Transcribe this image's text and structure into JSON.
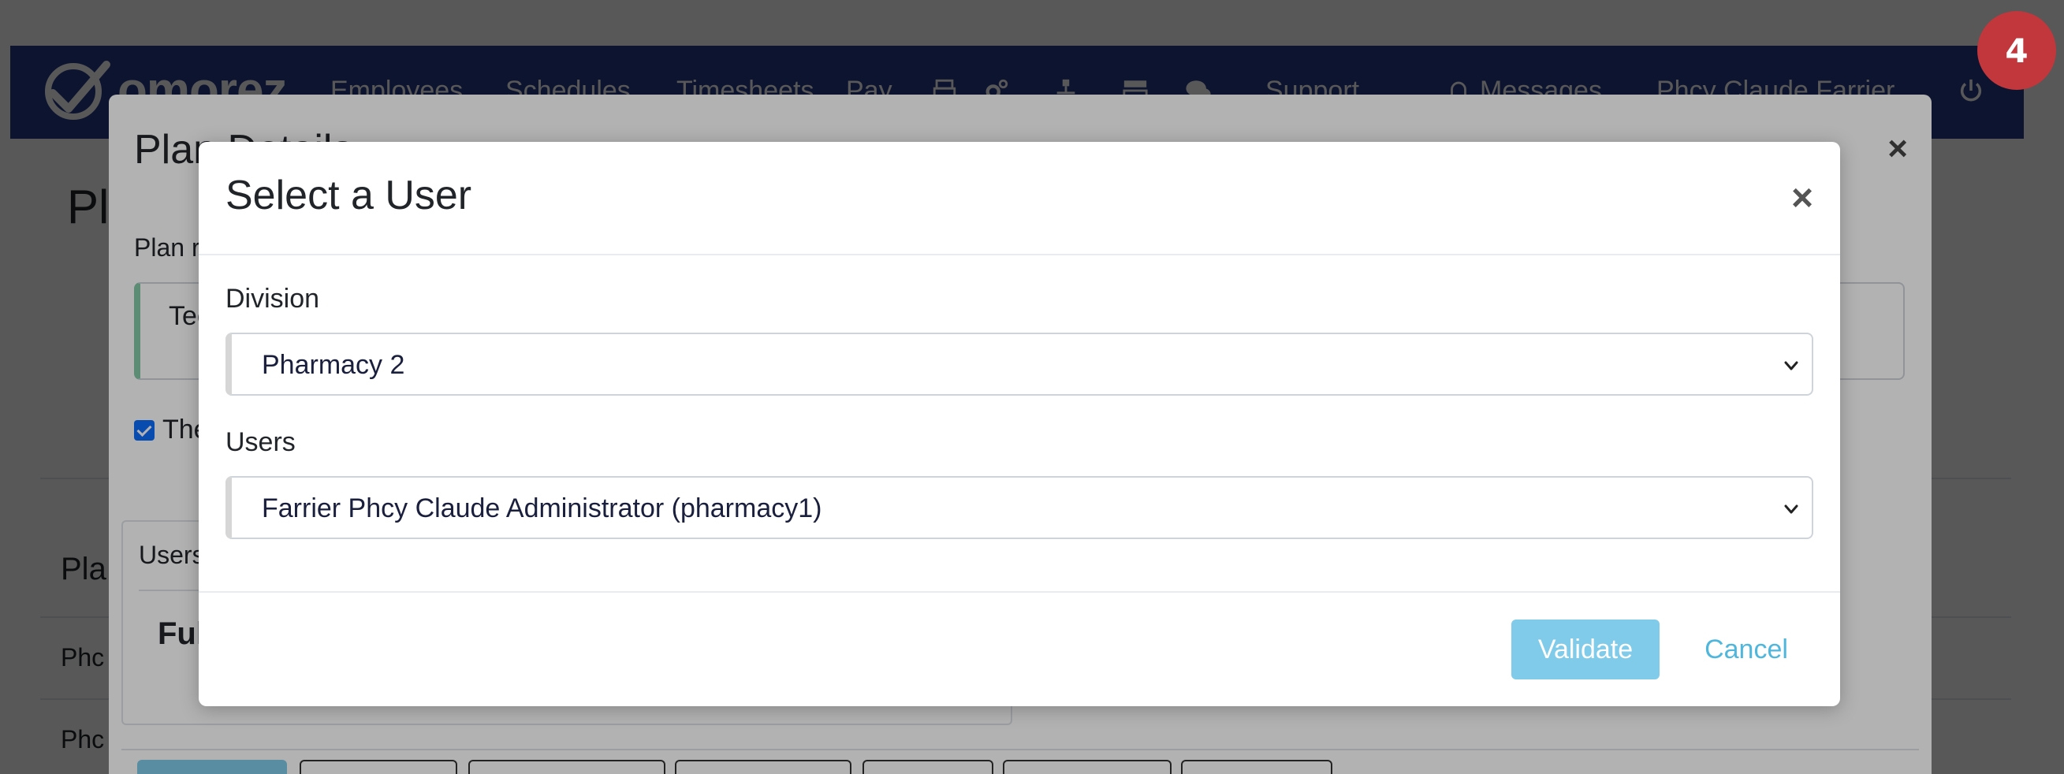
{
  "app": {
    "logo_text": "omorez",
    "nav": {
      "employees": "Employees",
      "schedules": "Schedules",
      "timesheets": "Timesheets",
      "pay": "Pay",
      "support": "Support",
      "messages": "Messages",
      "user": "Phcy Claude Farrier"
    },
    "page_title": "Pl",
    "section_title": "Pla",
    "rows": [
      "Phc",
      "Phc"
    ]
  },
  "plan_modal": {
    "title": "Plan Details",
    "close": "×",
    "plan_label": "Plan r",
    "plan_value": "Tec",
    "checkbox_label": "The",
    "users_header": "Users",
    "users_big": "Ful"
  },
  "user_modal": {
    "title": "Select a User",
    "close": "×",
    "division_label": "Division",
    "division_value": "Pharmacy 2",
    "users_label": "Users",
    "users_value": "Farrier Phcy Claude Administrator (pharmacy1)",
    "validate": "Validate",
    "cancel": "Cancel"
  },
  "step_badge": "4",
  "colors": {
    "navbar": "#283a8a",
    "validate_bg": "#7fcbe9",
    "cancel_text": "#4fb6dc",
    "badge": "#c1373c"
  }
}
